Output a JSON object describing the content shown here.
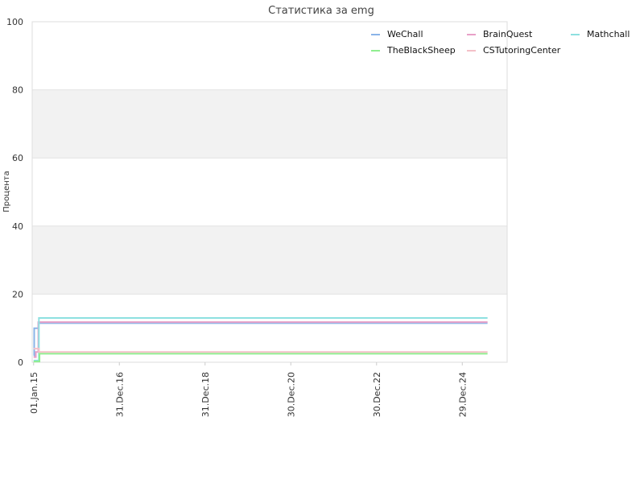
{
  "chart_data": {
    "type": "line",
    "title": "Статистика за emg",
    "ylabel": "Процента",
    "xlabel": "",
    "ylim": [
      0,
      100
    ],
    "yticks": [
      "0",
      "20",
      "40",
      "60",
      "80",
      "100"
    ],
    "xticks": [
      "01.Jan.15",
      "31.Dec.16",
      "31.Dec.18",
      "30.Dec.20",
      "30.Dec.22",
      "29.Dec.24"
    ],
    "xlim": [
      "2014-12-20",
      "2026-01-15"
    ],
    "grid": true,
    "legend_position": "top-right",
    "series": [
      {
        "name": "WeChall",
        "color": "#8ab4e8",
        "x": [
          "2015-01-01",
          "2015-01-06",
          "2015-02-10",
          "2025-08-01"
        ],
        "values": [
          2,
          10,
          11.5,
          11.5
        ]
      },
      {
        "name": "BrainQuest",
        "color": "#e8a0c8",
        "x": [
          "2015-01-01",
          "2015-01-20",
          "2015-02-10",
          "2025-08-01"
        ],
        "values": [
          1.5,
          3,
          11.8,
          11.8
        ]
      },
      {
        "name": "Mathchall",
        "color": "#8ee0e0",
        "x": [
          "2015-01-01",
          "2015-02-10",
          "2015-02-15",
          "2025-08-01"
        ],
        "values": [
          0.5,
          0.5,
          13,
          13
        ]
      },
      {
        "name": "TheBlackSheep",
        "color": "#90ee90",
        "x": [
          "2015-01-01",
          "2015-02-15",
          "2015-02-20",
          "2025-08-01"
        ],
        "values": [
          0.2,
          0.2,
          2.5,
          2.5
        ]
      },
      {
        "name": "CSTutoringCenter",
        "color": "#f4c0c8",
        "x": [
          "2015-01-01",
          "2015-02-10",
          "2015-02-15",
          "2025-08-01"
        ],
        "values": [
          4,
          4,
          3,
          3
        ]
      }
    ]
  }
}
